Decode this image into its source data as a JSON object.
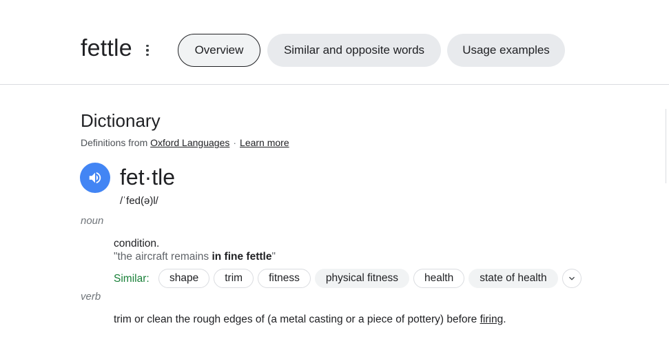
{
  "header": {
    "word": "fettle",
    "tabs": [
      {
        "label": "Overview",
        "active": true
      },
      {
        "label": "Similar and opposite words",
        "active": false
      },
      {
        "label": "Usage examples",
        "active": false
      }
    ]
  },
  "dictionary": {
    "heading": "Dictionary",
    "source_prefix": "Definitions from",
    "source_link": "Oxford Languages",
    "separator": "·",
    "learn_more": "Learn more",
    "headword": "fet·tle",
    "phonetic": "/ˈfed(ə)l/",
    "entries": [
      {
        "pos": "noun",
        "definition": "condition.",
        "example_open": "\"the aircraft remains ",
        "example_bold": "in fine fettle",
        "example_close": "\"",
        "similar_label": "Similar:",
        "similar": [
          "shape",
          "trim",
          "fitness",
          "physical fitness",
          "health",
          "state of health"
        ]
      },
      {
        "pos": "verb",
        "definition_before": "trim or clean the rough edges of (a metal casting or a piece of pottery) before ",
        "definition_link": "firing",
        "definition_after": "."
      }
    ]
  },
  "colors": {
    "speaker": "#4285f4",
    "similar_label": "#188038",
    "pos": "#70757a",
    "example": "#5f6368"
  },
  "icons": {
    "more": "more-vert-icon",
    "speaker": "volume-icon",
    "expand": "chevron-down-icon"
  }
}
